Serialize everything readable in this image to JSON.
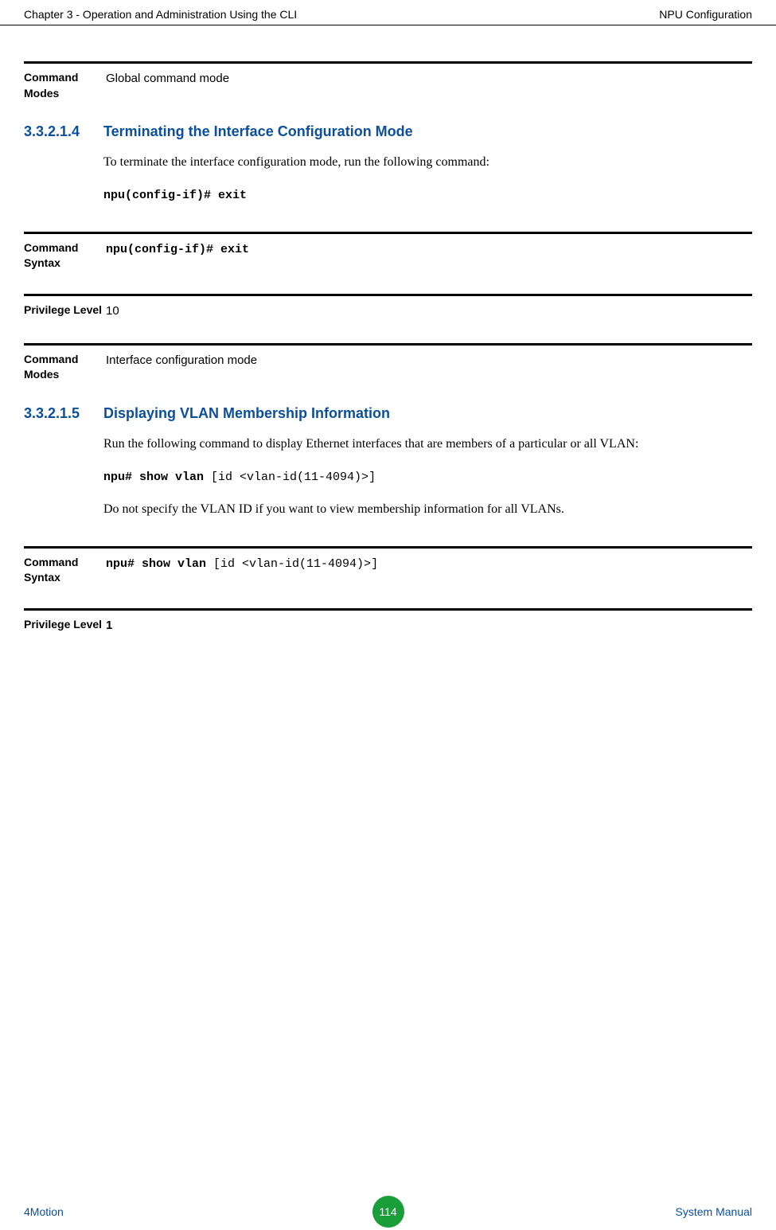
{
  "header": {
    "left": "Chapter 3 - Operation and Administration Using the CLI",
    "right": "NPU Configuration"
  },
  "row1": {
    "label": "Command Modes",
    "value": "Global command mode"
  },
  "section1": {
    "num": "3.3.2.1.4",
    "title": "Terminating the Interface Configuration Mode",
    "body1": "To terminate the interface configuration mode, run the following command:",
    "cmd": "npu(config-if)# exit"
  },
  "row2": {
    "label": "Command Syntax",
    "value_mono": "npu(config-if)# exit"
  },
  "row3": {
    "label": "Privilege Level",
    "value": "10"
  },
  "row4": {
    "label": "Command Modes",
    "value": "Interface configuration mode"
  },
  "section2": {
    "num": "3.3.2.1.5",
    "title": "Displaying VLAN Membership Information",
    "body1": "Run the following command to display Ethernet interfaces that are members of a particular or all VLAN:",
    "cmd_bold": "npu# show vlan ",
    "cmd_rest": "[id <vlan-id(11-4094)>]",
    "body2": "Do not specify the VLAN ID if you want to view membership information for all VLANs."
  },
  "row5": {
    "label": "Command Syntax",
    "value_bold": "npu# show vlan ",
    "value_rest": "[id <vlan-id(11-4094)>]"
  },
  "row6": {
    "label": "Privilege Level",
    "value": "1"
  },
  "footer": {
    "left": "4Motion",
    "page": "114",
    "right": "System Manual"
  }
}
